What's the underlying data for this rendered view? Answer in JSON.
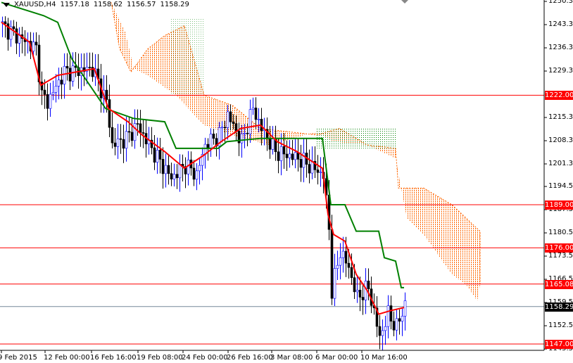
{
  "header": {
    "symbol": "XAUUSD,H4",
    "open": "1157.18",
    "high": "1158.62",
    "low": "1156.57",
    "close": "1158.29"
  },
  "y_axis": {
    "min": 1145.5,
    "max": 1250.3,
    "labels": [
      "1250.30",
      "1243.30",
      "1236.30",
      "1229.30",
      "1215.30",
      "1208.30",
      "1201.30",
      "1194.50",
      "1187.50",
      "1180.50",
      "1173.50",
      "1166.50",
      "1159.50",
      "1152.50",
      "1145.50"
    ]
  },
  "x_axis": {
    "labels": [
      "9 Feb 2015",
      "12 Feb 00:00",
      "16 Feb 16:00",
      "19 Feb 08:00",
      "24 Feb 00:00",
      "26 Feb 16:00",
      "3 Mar 08:00",
      "6 Mar 00:00",
      "10 Mar 16:00"
    ]
  },
  "levels": [
    {
      "price": 1222.0,
      "label": "1222.00",
      "color": "#ff0000"
    },
    {
      "price": 1189.0,
      "label": "1189.00",
      "color": "#ff0000"
    },
    {
      "price": 1176.0,
      "label": "1176.00",
      "color": "#ff0000"
    },
    {
      "price": 1165.08,
      "label": "1165.08",
      "color": "#ff0000"
    },
    {
      "price": 1147.0,
      "label": "1147.00",
      "color": "#ff0000"
    }
  ],
  "bid": {
    "price": 1158.29,
    "label": "1158.29",
    "color": "#000000"
  },
  "colors": {
    "bull": "#0000ff",
    "bear": "#000000",
    "tenkan": "#ff0000",
    "kijun": "#008000",
    "cloud_bear": "#ff6600",
    "cloud_bull": "#008000"
  },
  "chart_data": {
    "type": "candlestick",
    "close_anchors": [
      [
        0,
        1243
      ],
      [
        5,
        1240
      ],
      [
        12,
        1236
      ],
      [
        14,
        1222
      ],
      [
        16,
        1220
      ],
      [
        22,
        1229
      ],
      [
        32,
        1230
      ],
      [
        37,
        1220
      ],
      [
        39,
        1207
      ],
      [
        44,
        1209
      ],
      [
        48,
        1213
      ],
      [
        52,
        1207
      ],
      [
        60,
        1197
      ],
      [
        65,
        1201
      ],
      [
        69,
        1198
      ],
      [
        72,
        1207
      ],
      [
        77,
        1210
      ],
      [
        80,
        1216
      ],
      [
        85,
        1208
      ],
      [
        89,
        1218
      ],
      [
        92,
        1212
      ],
      [
        97,
        1205
      ],
      [
        105,
        1203
      ],
      [
        114,
        1198
      ],
      [
        116,
        1182
      ],
      [
        117,
        1163
      ],
      [
        120,
        1175
      ],
      [
        123,
        1170
      ],
      [
        126,
        1161
      ],
      [
        130,
        1164
      ],
      [
        134,
        1149
      ],
      [
        137,
        1156
      ],
      [
        140,
        1152
      ],
      [
        143,
        1159
      ]
    ],
    "tenkan": [
      [
        0,
        1244
      ],
      [
        10,
        1238
      ],
      [
        14,
        1225
      ],
      [
        20,
        1228
      ],
      [
        33,
        1230
      ],
      [
        38,
        1218
      ],
      [
        45,
        1214
      ],
      [
        50,
        1210
      ],
      [
        58,
        1205
      ],
      [
        65,
        1200
      ],
      [
        72,
        1204
      ],
      [
        78,
        1208
      ],
      [
        85,
        1212
      ],
      [
        92,
        1213
      ],
      [
        98,
        1208
      ],
      [
        105,
        1205
      ],
      [
        114,
        1200
      ],
      [
        116,
        1186
      ],
      [
        118,
        1180
      ],
      [
        122,
        1178
      ],
      [
        126,
        1168
      ],
      [
        130,
        1163
      ],
      [
        134,
        1156
      ],
      [
        138,
        1157
      ],
      [
        143,
        1158
      ]
    ],
    "kijun": [
      [
        0,
        1250
      ],
      [
        15,
        1246
      ],
      [
        20,
        1244
      ],
      [
        25,
        1233
      ],
      [
        37,
        1218
      ],
      [
        47,
        1215
      ],
      [
        58,
        1214
      ],
      [
        62,
        1206
      ],
      [
        77,
        1206
      ],
      [
        80,
        1208
      ],
      [
        92,
        1209
      ],
      [
        114,
        1209
      ],
      [
        117,
        1189
      ],
      [
        122,
        1189
      ],
      [
        126,
        1181
      ],
      [
        134,
        1181
      ],
      [
        136,
        1173
      ],
      [
        140,
        1172
      ],
      [
        142,
        1164
      ],
      [
        143,
        1164
      ]
    ],
    "cloud_upper": [
      [
        39,
        1250
      ],
      [
        42,
        1236
      ],
      [
        46,
        1229
      ],
      [
        52,
        1236
      ],
      [
        58,
        1240
      ],
      [
        65,
        1243
      ],
      [
        72,
        1222
      ],
      [
        82,
        1219
      ],
      [
        92,
        1212
      ],
      [
        112,
        1210
      ],
      [
        120,
        1212
      ],
      [
        130,
        1207
      ],
      [
        140,
        1206
      ],
      [
        141,
        1194
      ],
      [
        150,
        1194
      ],
      [
        160,
        1189
      ],
      [
        170,
        1181
      ],
      [
        170,
        1165
      ]
    ],
    "cloud_lower": [
      [
        39,
        1250
      ],
      [
        44,
        1241
      ],
      [
        47,
        1230
      ],
      [
        52,
        1228
      ],
      [
        62,
        1222
      ],
      [
        72,
        1213
      ],
      [
        82,
        1210
      ],
      [
        95,
        1207
      ],
      [
        112,
        1211
      ],
      [
        118,
        1208
      ],
      [
        130,
        1207
      ],
      [
        140,
        1203
      ],
      [
        144,
        1185
      ],
      [
        150,
        1180
      ],
      [
        160,
        1168
      ],
      [
        165,
        1165
      ],
      [
        169,
        1160
      ]
    ]
  }
}
